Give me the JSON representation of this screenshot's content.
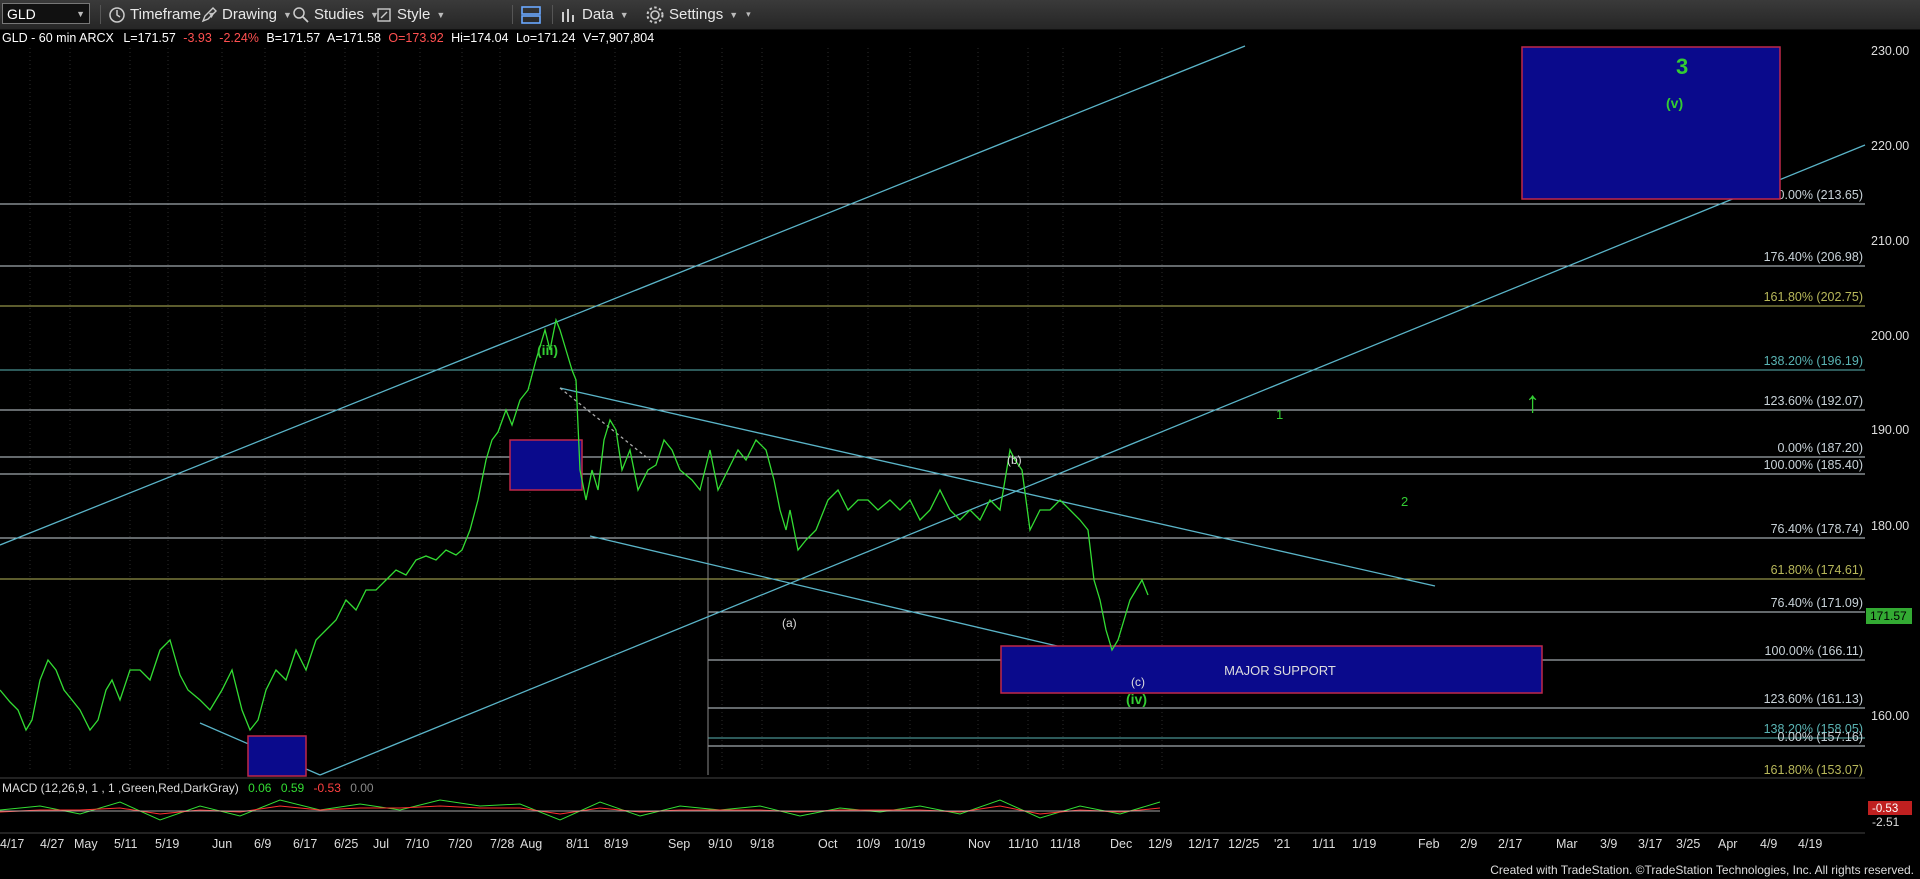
{
  "toolbar": {
    "symbol": "GLD",
    "timeframe": "Timeframe",
    "drawing": "Drawing",
    "studies": "Studies",
    "style": "Style",
    "data": "Data",
    "settings": "Settings"
  },
  "header": {
    "title": "GLD - 60 min  ARCX",
    "last": "L=171.57",
    "change": "-3.93",
    "change_pct": "-2.24%",
    "bid": "B=171.57",
    "ask": "A=171.58",
    "open": "O=173.92",
    "high": "Hi=174.04",
    "low": "Lo=171.24",
    "volume": "V=7,907,804"
  },
  "colors": {
    "background": "#000000",
    "price": "#33dd33",
    "trendline": "#5ab4c8",
    "fib_line": "#c8d2d8",
    "box_fill": "#0a0a8c",
    "box_border": "#c0284a",
    "label_green": "#33cc33",
    "label_yellow": "#d8d85a",
    "label_white": "#dddddd"
  },
  "price_axis": {
    "labels": [
      "230.00",
      "220.00",
      "210.00",
      "200.00",
      "190.00",
      "180.00",
      "170.00",
      "160.00"
    ],
    "current": "171.57",
    "macd_value": "-0.53",
    "macd_axis": "-2.51"
  },
  "time_axis": {
    "labels": [
      "4/17",
      "4/27",
      "May",
      "5/11",
      "5/19",
      "Jun",
      "6/9",
      "6/17",
      "6/25",
      "Jul",
      "7/10",
      "7/20",
      "7/28",
      "Aug",
      "8/11",
      "8/19",
      "Sep",
      "9/10",
      "9/18",
      "Oct",
      "10/9",
      "10/19",
      "Nov",
      "11/10",
      "11/18",
      "Dec",
      "12/9",
      "12/17",
      "12/25",
      "'21",
      "1/11",
      "1/19",
      "Feb",
      "2/9",
      "2/17",
      "Mar",
      "3/9",
      "3/17",
      "3/25",
      "Apr",
      "4/9",
      "4/19"
    ]
  },
  "fib_labels": [
    {
      "text": "200.00% (213.65)",
      "price": 213.65,
      "color": "#c8d2d8"
    },
    {
      "text": "176.40% (206.98)",
      "price": 206.98,
      "color": "#c8d2d8"
    },
    {
      "text": "161.80% (202.75)",
      "price": 202.75,
      "color": "#b8b85a"
    },
    {
      "text": "138.20% (196.19)",
      "price": 196.19,
      "color": "#5ab4b4"
    },
    {
      "text": "123.60% (192.07)",
      "price": 192.07,
      "color": "#c8d2d8"
    },
    {
      "text": "0.00% (187.20)",
      "price": 187.2,
      "color": "#c8d2d8"
    },
    {
      "text": "100.00% (185.40)",
      "price": 185.4,
      "color": "#c8d2d8"
    },
    {
      "text": "76.40% (178.74)",
      "price": 178.74,
      "color": "#c8d2d8"
    },
    {
      "text": "61.80% (174.61)",
      "price": 174.61,
      "color": "#b8b85a"
    },
    {
      "text": "76.40% (171.09)",
      "price": 171.09,
      "color": "#c8d2d8"
    },
    {
      "text": "100.00% (166.11)",
      "price": 166.11,
      "color": "#c8d2d8"
    },
    {
      "text": "123.60% (161.13)",
      "price": 161.13,
      "color": "#c8d2d8"
    },
    {
      "text": "138.20% (158.05)",
      "price": 158.05,
      "color": "#5ab4b4"
    },
    {
      "text": "0.00% (157.16)",
      "price": 157.16,
      "color": "#c8d2d8"
    },
    {
      "text": "161.80% (153.07)",
      "price": 153.07,
      "color": "#b8b85a"
    }
  ],
  "annotations": {
    "major_support": "MAJOR SUPPORT",
    "wave_3": "3",
    "wave_v_target": "(v)",
    "wave_iii": "(iii)",
    "wave_iv": "(iv)",
    "wave_b": "(b)",
    "wave_c": "(c)",
    "wave_a_paren": "(a)",
    "wave_1": "1",
    "wave_2": "2",
    "arrow": "↑"
  },
  "macd": {
    "label": "MACD (12,26,9, 1 , 1 ,Green,Red,DarkGray)",
    "v1": "0.06",
    "v2": "0.59",
    "v3": "-0.53",
    "v4": "0.00"
  },
  "footer": "Created with TradeStation. ©TradeStation Technologies, Inc. All rights reserved."
}
